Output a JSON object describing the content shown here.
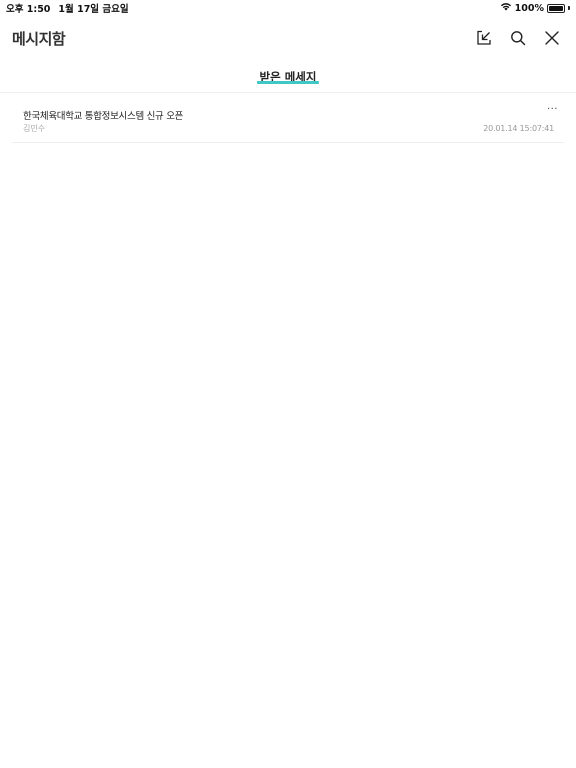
{
  "status_bar": {
    "time": "오후 1:50",
    "date": "1월 17일 금요일",
    "battery": "100%"
  },
  "header": {
    "title": "메시지함",
    "icons": [
      "download-icon",
      "search-icon",
      "close-icon"
    ]
  },
  "tabs": [
    {
      "label": "받은 메세지",
      "active": true
    }
  ],
  "messages": [
    {
      "title": "한국체육대학교 통합정보시스템 신규 오픈",
      "sender": "김민수",
      "time": "20.01.14 15:07:41",
      "more": "···"
    }
  ],
  "colors": {
    "accent": "#3fc7c4",
    "divider": "#eeeeee"
  }
}
